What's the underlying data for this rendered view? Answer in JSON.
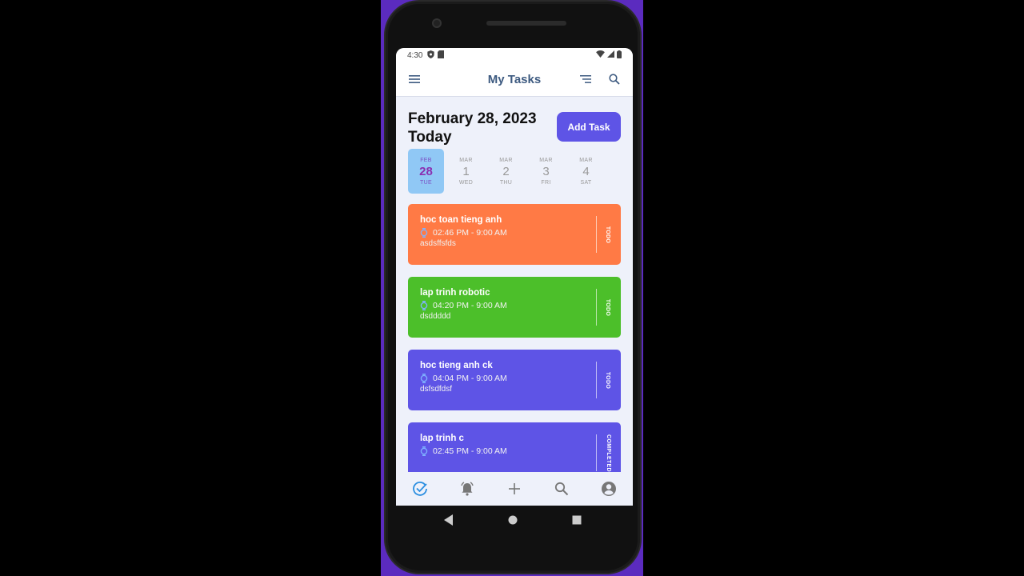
{
  "status_bar": {
    "time": "4:30"
  },
  "app_bar": {
    "title": "My Tasks"
  },
  "header": {
    "date": "February 28, 2023",
    "subtitle": "Today",
    "add_button": "Add Task"
  },
  "date_picker": [
    {
      "month": "FEB",
      "day": "28",
      "weekday": "TUE",
      "selected": true
    },
    {
      "month": "MAR",
      "day": "1",
      "weekday": "WED",
      "selected": false
    },
    {
      "month": "MAR",
      "day": "2",
      "weekday": "THU",
      "selected": false
    },
    {
      "month": "MAR",
      "day": "3",
      "weekday": "FRI",
      "selected": false
    },
    {
      "month": "MAR",
      "day": "4",
      "weekday": "SAT",
      "selected": false
    }
  ],
  "tasks": [
    {
      "title": "hoc toan tieng anh",
      "time": "02:46 PM - 9:00 AM",
      "note": "asdsffsfds",
      "status": "TODO",
      "color": "#ff7a45"
    },
    {
      "title": "lap trinh robotic",
      "time": "04:20 PM - 9:00 AM",
      "note": "dsddddd",
      "status": "TODO",
      "color": "#4cbf2a"
    },
    {
      "title": "hoc tieng anh ck",
      "time": "04:04 PM - 9:00 AM",
      "note": "dsfsdfdsf",
      "status": "TODO",
      "color": "#5e54e6"
    },
    {
      "title": "lap trinh c",
      "time": "02:45 PM - 9:00 AM",
      "note": "",
      "status": "COMPLETED",
      "color": "#5e54e6"
    }
  ],
  "bottom_nav": [
    "check-circle-icon",
    "bell-icon",
    "plus-icon",
    "search-icon",
    "account-icon"
  ],
  "colors": {
    "accent": "#5e54e6",
    "title": "#3d5a80",
    "selected_day": "#90c8f5"
  }
}
